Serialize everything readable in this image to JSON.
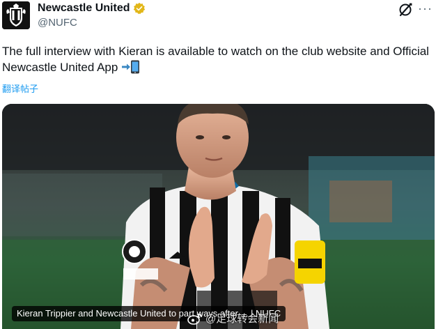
{
  "post": {
    "display_name": "Newcastle United",
    "handle": "@NUFC",
    "text": "The full interview with Kieran is available to watch on the club website and Official Newcastle United App",
    "translate_label": "翻译帖子",
    "more_label": "···"
  },
  "media": {
    "card_title": "Kieran Trippier and Newcastle United to part ways after ... | NUFC",
    "watermark": "@足球转会新闻"
  },
  "colors": {
    "accent": "#1d9bf0",
    "verified_badge": "#e2b719",
    "handle": "#536471"
  },
  "icons": {
    "avatar": "nufc-crest",
    "verified": "gold-verified-badge",
    "grok": "grok-icon",
    "emoji": "mobile-phone-with-arrow"
  }
}
